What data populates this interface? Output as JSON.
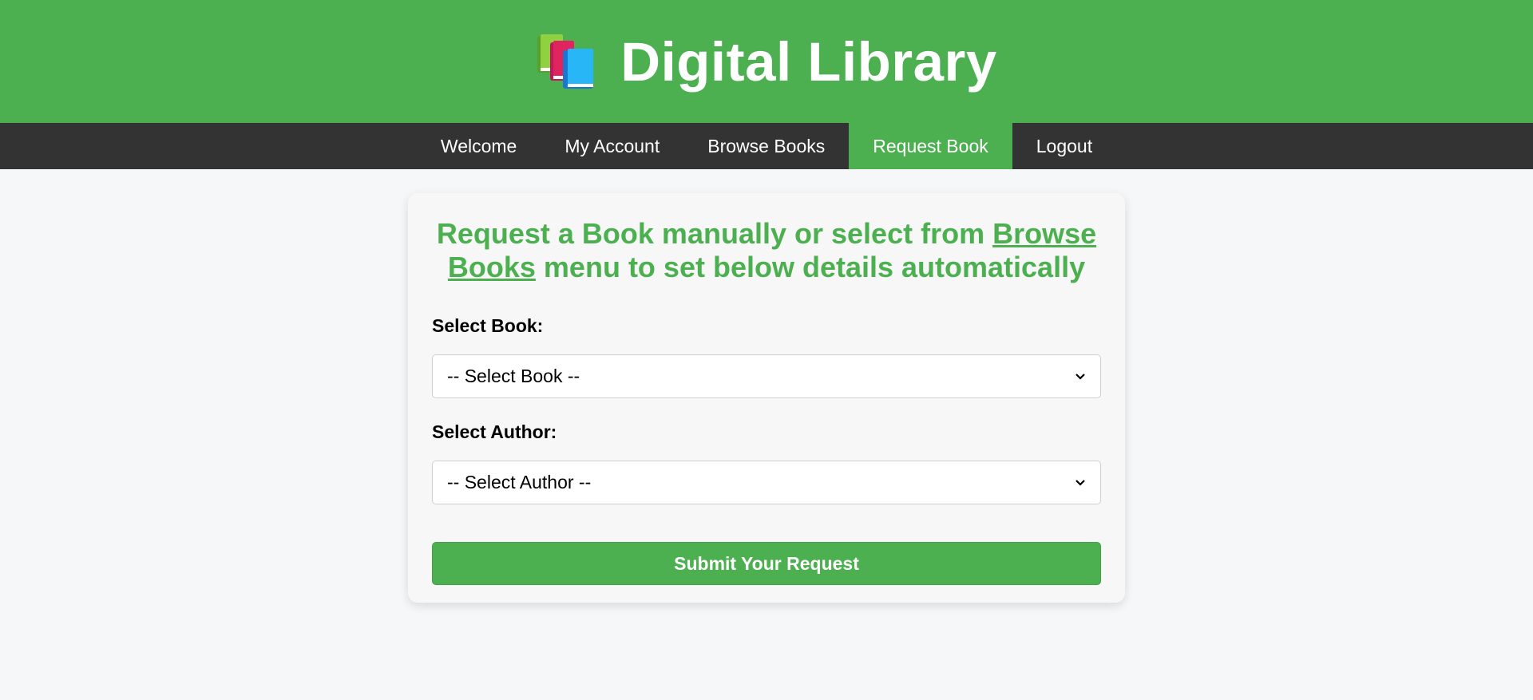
{
  "header": {
    "icon": "books-icon",
    "title": "Digital Library"
  },
  "nav": {
    "items": [
      {
        "label": "Welcome",
        "active": false
      },
      {
        "label": "My Account",
        "active": false
      },
      {
        "label": "Browse Books",
        "active": false
      },
      {
        "label": "Request Book",
        "active": true
      },
      {
        "label": "Logout",
        "active": false
      }
    ]
  },
  "card": {
    "heading_prefix": "Request a Book manually or select from ",
    "heading_link": "Browse Books",
    "heading_suffix": " menu to set below details automatically",
    "book_label": "Select Book:",
    "book_select_value": "-- Select Book --",
    "author_label": "Select Author:",
    "author_select_value": "-- Select Author --",
    "submit_label": "Submit Your Request"
  },
  "colors": {
    "brand_green": "#4caf50",
    "nav_background": "#333333",
    "page_background": "#f6f7f9"
  }
}
